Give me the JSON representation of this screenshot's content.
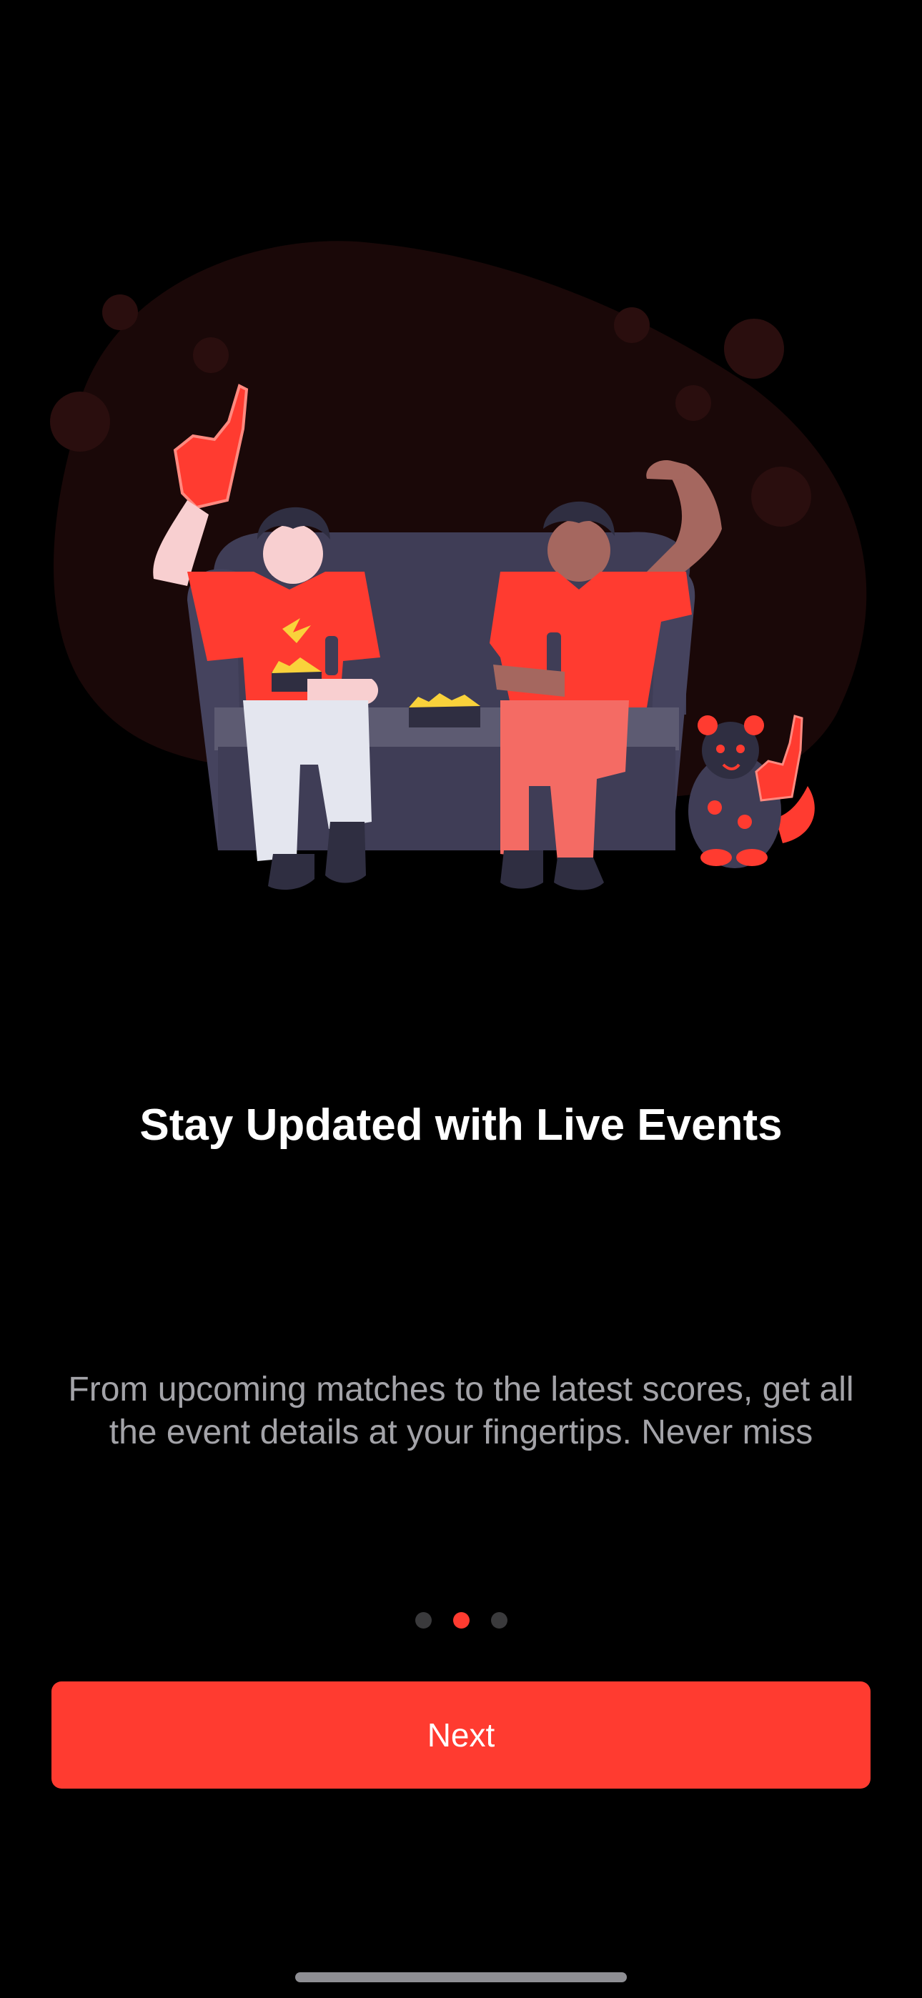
{
  "onboarding": {
    "title": "Stay Updated with Live Events",
    "description": "From upcoming matches to the latest scores, get all the event details at your fingertips. Never miss",
    "pager": {
      "page_count": 3,
      "current_page": 2
    },
    "next_label": "Next"
  },
  "illustration": {
    "name": "sports-fans-on-couch-illustration"
  },
  "colors": {
    "background": "#000000",
    "accent": "#ff3b30",
    "title_text": "#ffffff",
    "body_text": "#a3a3a8",
    "dot_inactive": "#3a3a3c",
    "blob": "#1a0808",
    "couch": "#3f3d56",
    "jersey": "#ff3b30"
  }
}
